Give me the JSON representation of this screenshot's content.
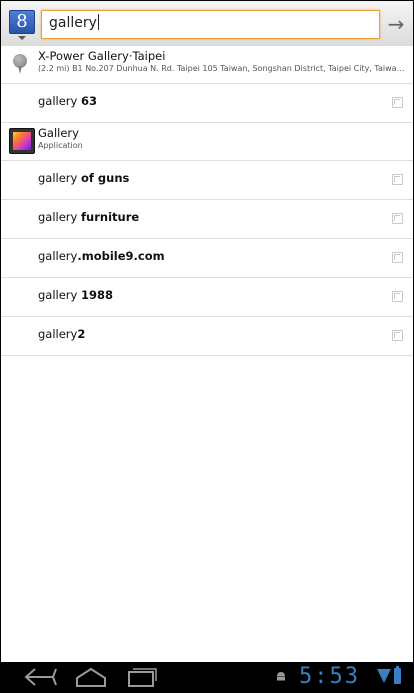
{
  "search": {
    "query": "gallery",
    "source_logo": "8",
    "go_glyph": "→"
  },
  "suggestions": [
    {
      "kind": "place",
      "title": "X-Power Gallery·Taipei",
      "subtitle": "(2.2 mi) B1 No.207 Dunhua N. Rd. Taipei 105 Taiwan, Songshan District, Taipei City, Taiwan 1...",
      "icon": "map-pin-icon"
    },
    {
      "kind": "query",
      "prefix": "gallery ",
      "bold": "63",
      "icon": "refine-arrow-icon"
    },
    {
      "kind": "app",
      "title": "Gallery",
      "subtitle": "Application",
      "icon": "gallery-app-icon"
    },
    {
      "kind": "query",
      "prefix": "gallery ",
      "bold": "of guns",
      "icon": "refine-arrow-icon"
    },
    {
      "kind": "query",
      "prefix": "gallery ",
      "bold": "furniture",
      "icon": "refine-arrow-icon"
    },
    {
      "kind": "query",
      "prefix": "gallery",
      "bold": ".mobile9.com",
      "icon": "refine-arrow-icon"
    },
    {
      "kind": "query",
      "prefix": "gallery ",
      "bold": "1988",
      "icon": "refine-arrow-icon"
    },
    {
      "kind": "query",
      "prefix": "gallery",
      "bold": "2",
      "icon": "refine-arrow-icon"
    }
  ],
  "status": {
    "time": "5:53"
  },
  "colors": {
    "accent": "#3a7fc4",
    "focus_border": "#e8a13a"
  }
}
